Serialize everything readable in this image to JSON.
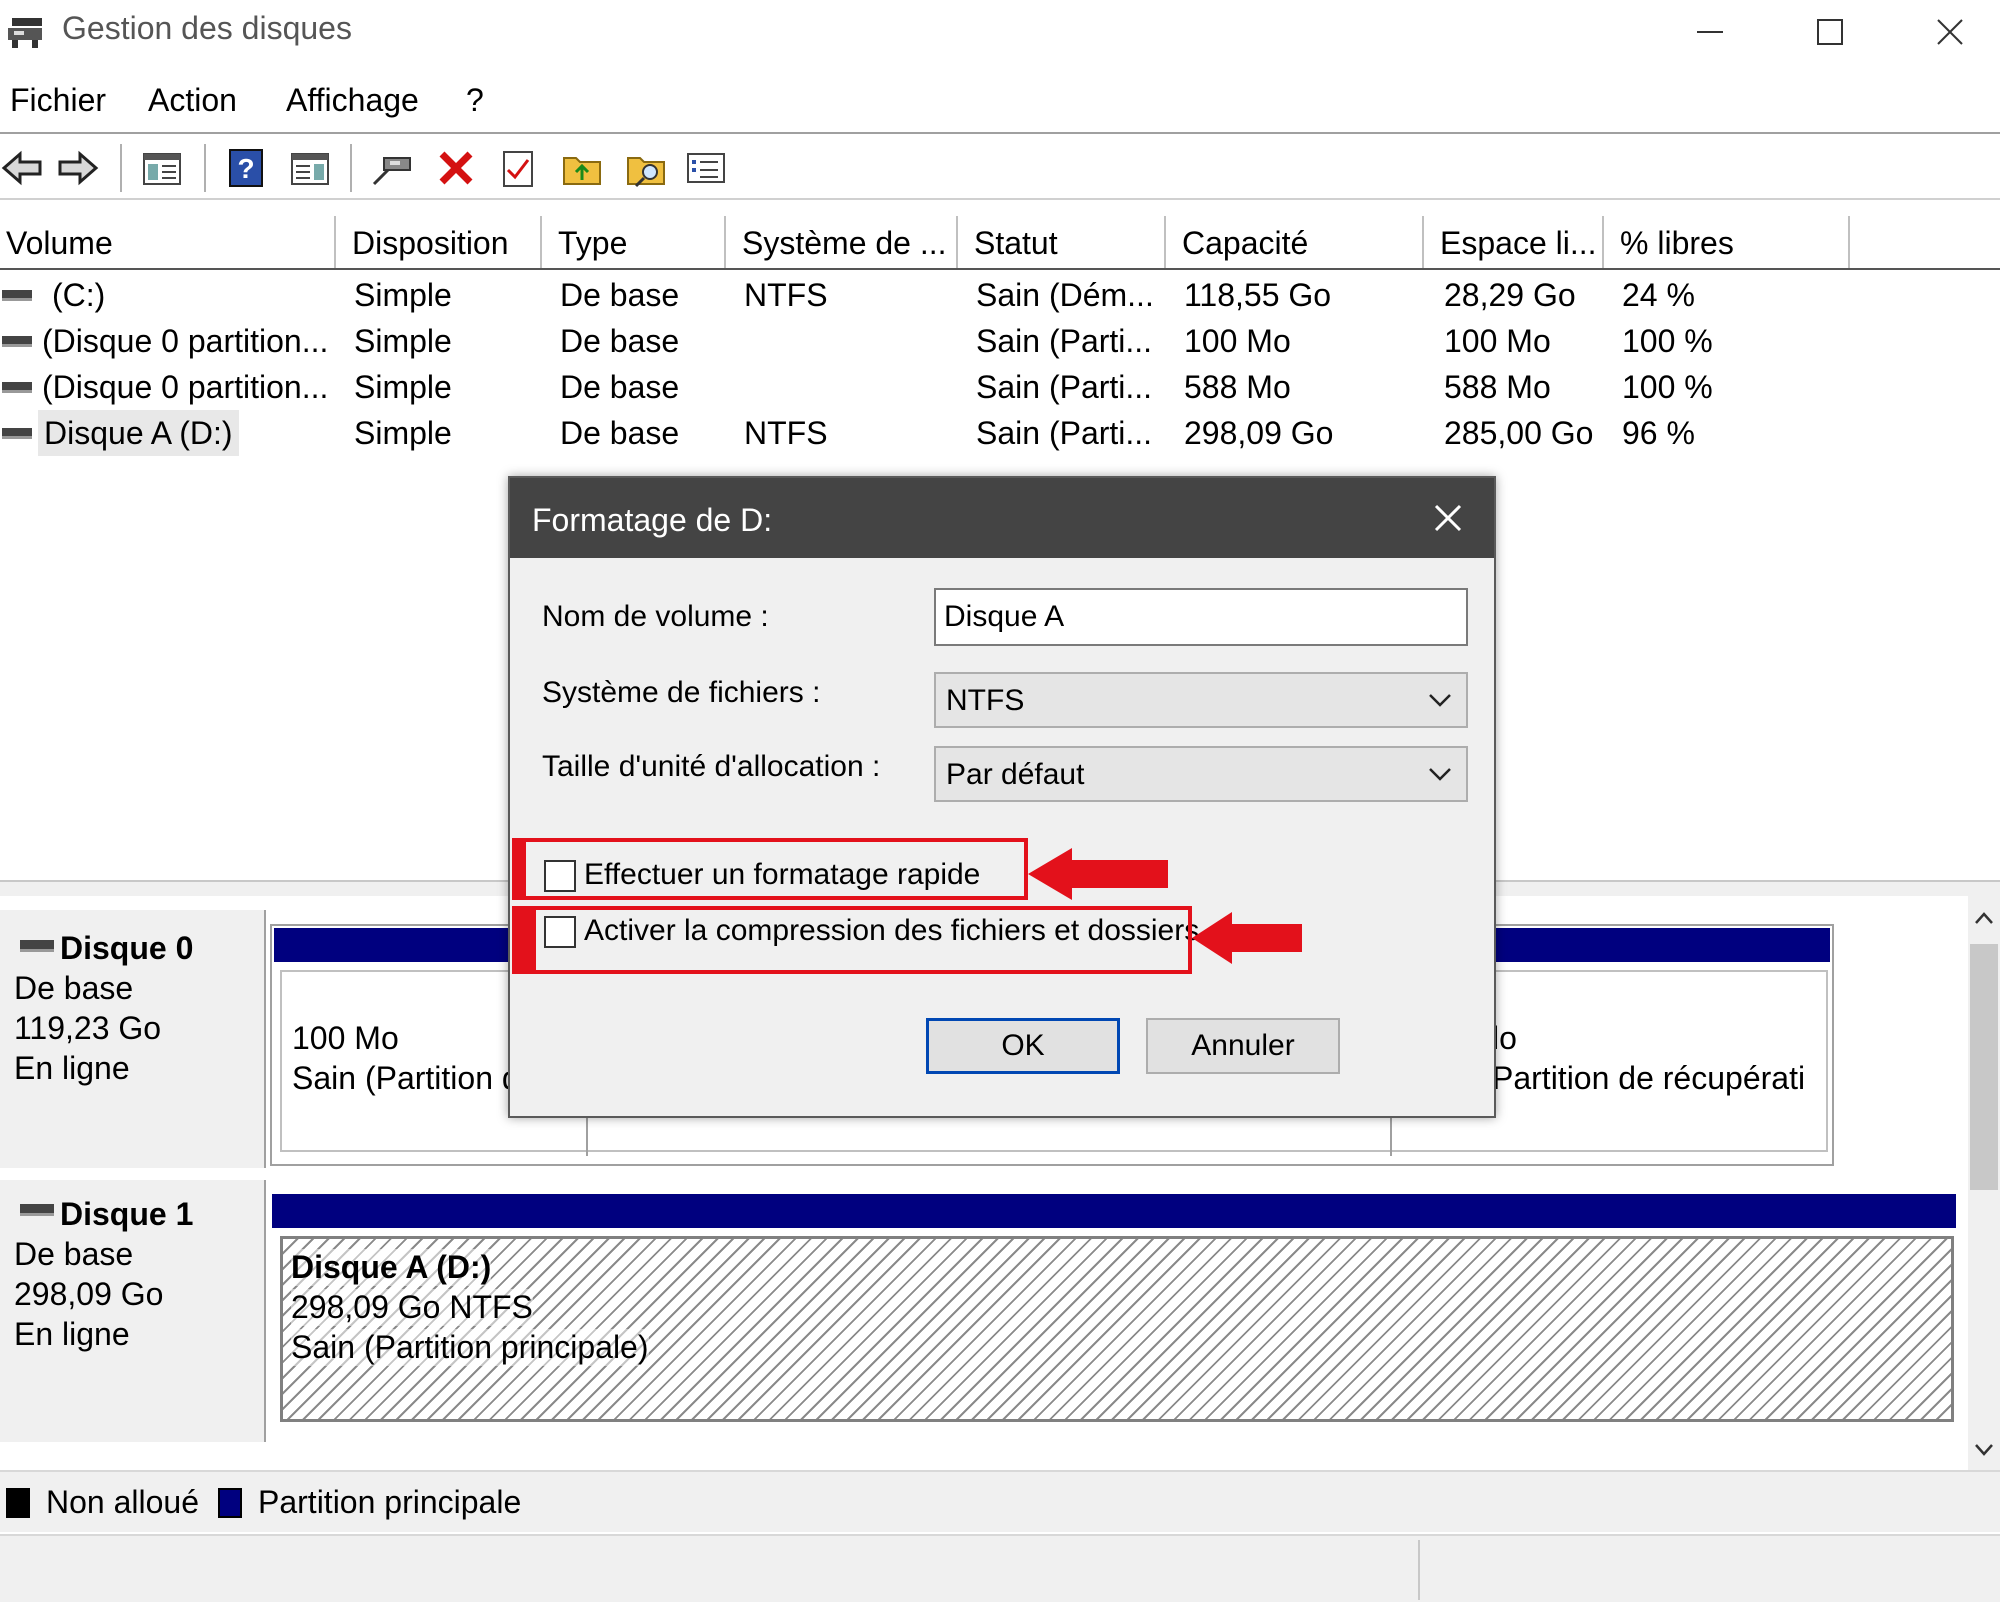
{
  "window": {
    "title": "Gestion des disques"
  },
  "menu": [
    "Fichier",
    "Action",
    "Affichage",
    "?"
  ],
  "toolbar": [
    "back-icon",
    "forward-icon",
    "console-tree-icon",
    "help-icon",
    "properties-view-icon",
    "connect-icon",
    "delete-icon",
    "checkmark-doc-icon",
    "folder-up-icon",
    "folder-search-icon",
    "list-view-icon"
  ],
  "table": {
    "headers": [
      "Volume",
      "Disposition",
      "Type",
      "Système de ...",
      "Statut",
      "Capacité",
      "Espace li...",
      "% libres"
    ],
    "rows": [
      [
        "(C:)",
        "Simple",
        "De base",
        "NTFS",
        "Sain (Dém...",
        "118,55 Go",
        "28,29 Go",
        "24 %"
      ],
      [
        "(Disque 0 partition...",
        "Simple",
        "De base",
        "",
        "Sain (Parti...",
        "100 Mo",
        "100 Mo",
        "100 %"
      ],
      [
        "(Disque 0 partition...",
        "Simple",
        "De base",
        "",
        "Sain (Parti...",
        "588 Mo",
        "588 Mo",
        "100 %"
      ],
      [
        "Disque A (D:)",
        "Simple",
        "De base",
        "NTFS",
        "Sain (Parti...",
        "298,09 Go",
        "285,00 Go",
        "96 %"
      ]
    ]
  },
  "disks": [
    {
      "name": "Disque 0",
      "type": "De base",
      "size": "119,23 Go",
      "status": "En ligne",
      "partitions": [
        {
          "line1": "100 Mo",
          "line2": "Sain (Partition d"
        },
        {
          "line1": "lo",
          "line2": "Partition de récupérati"
        }
      ]
    },
    {
      "name": "Disque 1",
      "type": "De base",
      "size": "298,09 Go",
      "status": "En ligne",
      "partitions": [
        {
          "line1": "Disque A  (D:)",
          "line2": "298,09 Go NTFS",
          "line3": "Sain (Partition principale)"
        }
      ]
    }
  ],
  "legend": [
    {
      "label": "Non alloué",
      "color": "#000000"
    },
    {
      "label": "Partition principale",
      "color": "#00007f"
    }
  ],
  "dialog": {
    "title": "Formatage de D:",
    "volume_label": "Nom de volume :",
    "volume_value": "Disque A",
    "fs_label": "Système de fichiers :",
    "fs_value": "NTFS",
    "alloc_label": "Taille d'unité d'allocation :",
    "alloc_value": "Par défaut",
    "quick_format": "Effectuer un formatage rapide",
    "compression": "Activer la compression des fichiers et dossiers",
    "ok": "OK",
    "cancel": "Annuler"
  },
  "colors": {
    "partition_bar": "#00007f",
    "highlight": "#e3111b",
    "dialog_title": "#444444"
  }
}
